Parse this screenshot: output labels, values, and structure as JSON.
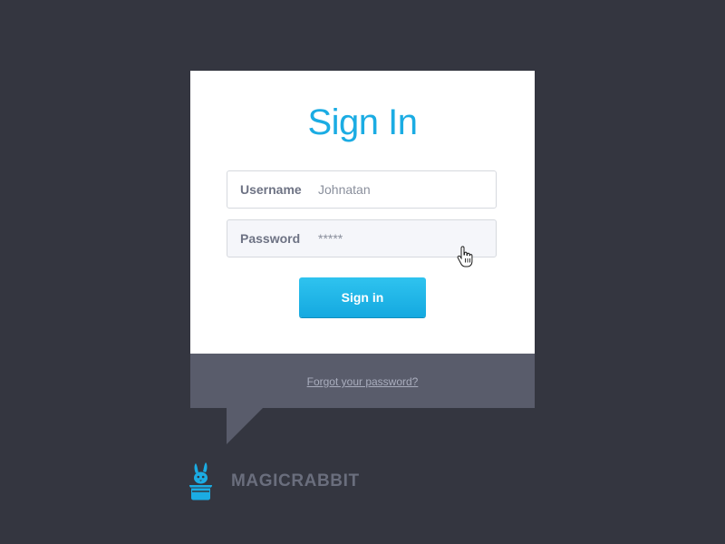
{
  "colors": {
    "background": "#343640",
    "card": "#ffffff",
    "accent": "#1bace3",
    "footer": "#595c6b",
    "brand_text": "#6a6e7d"
  },
  "form": {
    "title": "Sign In",
    "username": {
      "label": "Username",
      "value": "Johnatan"
    },
    "password": {
      "label": "Password",
      "value": "*****"
    },
    "submit_label": "Sign in"
  },
  "footer": {
    "forgot_link": "Forgot your password?"
  },
  "brand": {
    "name": "MAGICRABBIT",
    "logo_icon": "rabbit-in-hat-icon"
  },
  "cursor": {
    "icon": "hand-pointer-icon"
  }
}
